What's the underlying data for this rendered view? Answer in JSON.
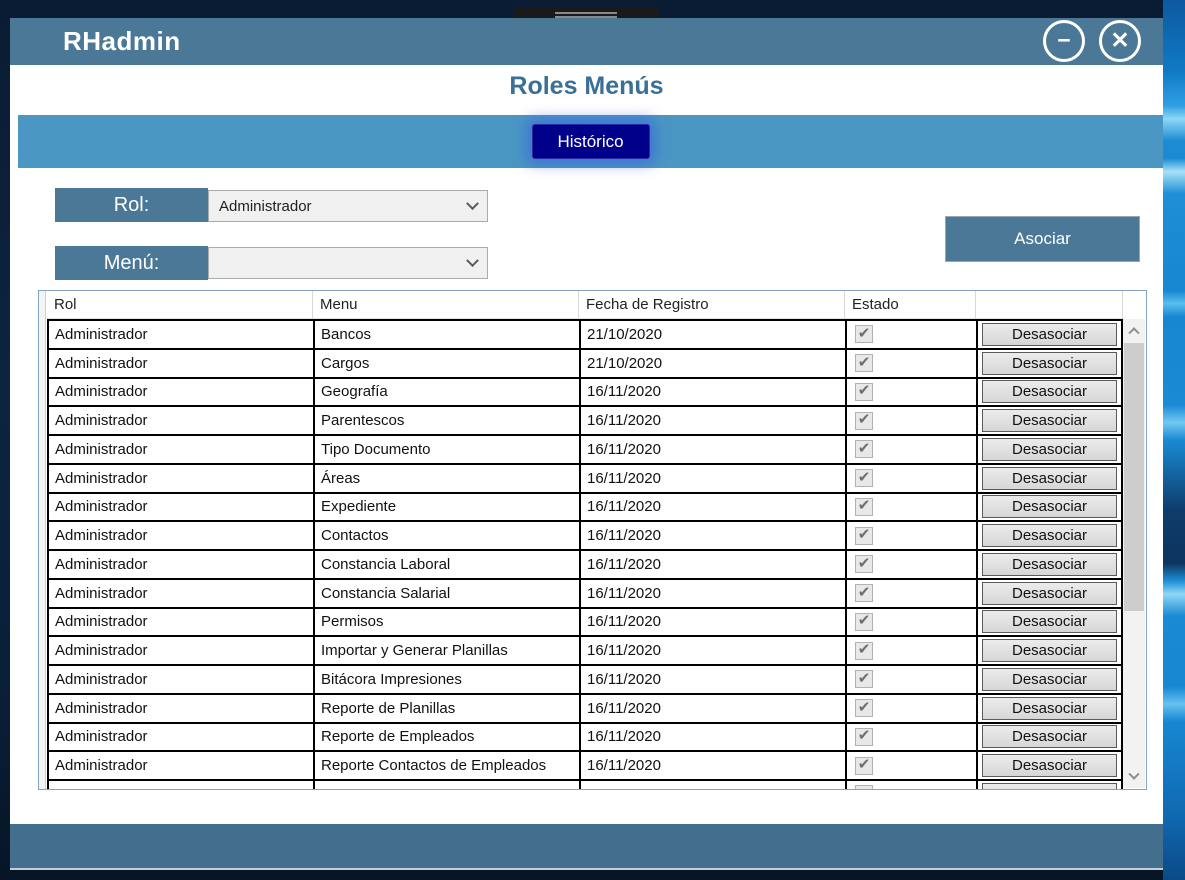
{
  "window": {
    "title": "RHadmin"
  },
  "icons": {
    "minimize": "−",
    "close": "✕",
    "check": "✔"
  },
  "page": {
    "title": "Roles Menús"
  },
  "toolbar": {
    "historico_label": "Histórico"
  },
  "filters": {
    "rol_label": "Rol:",
    "rol_value": "Administrador",
    "menu_label": "Menú:",
    "menu_value": "",
    "asociar_label": "Asociar"
  },
  "table": {
    "headers": [
      "Rol",
      "Menu",
      "Fecha de Registro",
      "Estado",
      ""
    ],
    "action_label": "Desasociar",
    "rows": [
      {
        "rol": "Administrador",
        "menu": "Bancos",
        "fecha": "21/10/2020",
        "estado": true
      },
      {
        "rol": "Administrador",
        "menu": "Cargos",
        "fecha": "21/10/2020",
        "estado": true
      },
      {
        "rol": "Administrador",
        "menu": "Geografía",
        "fecha": "16/11/2020",
        "estado": true
      },
      {
        "rol": "Administrador",
        "menu": "Parentescos",
        "fecha": "16/11/2020",
        "estado": true
      },
      {
        "rol": "Administrador",
        "menu": "Tipo Documento",
        "fecha": "16/11/2020",
        "estado": true
      },
      {
        "rol": "Administrador",
        "menu": "Áreas",
        "fecha": "16/11/2020",
        "estado": true
      },
      {
        "rol": "Administrador",
        "menu": "Expediente",
        "fecha": "16/11/2020",
        "estado": true
      },
      {
        "rol": "Administrador",
        "menu": "Contactos",
        "fecha": "16/11/2020",
        "estado": true
      },
      {
        "rol": "Administrador",
        "menu": "Constancia Laboral",
        "fecha": "16/11/2020",
        "estado": true
      },
      {
        "rol": "Administrador",
        "menu": "Constancia Salarial",
        "fecha": "16/11/2020",
        "estado": true
      },
      {
        "rol": "Administrador",
        "menu": "Permisos",
        "fecha": "16/11/2020",
        "estado": true
      },
      {
        "rol": "Administrador",
        "menu": "Importar y Generar Planillas",
        "fecha": "16/11/2020",
        "estado": true
      },
      {
        "rol": "Administrador",
        "menu": "Bitácora Impresiones",
        "fecha": "16/11/2020",
        "estado": true
      },
      {
        "rol": "Administrador",
        "menu": "Reporte de Planillas",
        "fecha": "16/11/2020",
        "estado": true
      },
      {
        "rol": "Administrador",
        "menu": "Reporte de Empleados",
        "fecha": "16/11/2020",
        "estado": true
      },
      {
        "rol": "Administrador",
        "menu": "Reporte Contactos de Empleados",
        "fecha": "16/11/2020",
        "estado": true
      }
    ],
    "partial_row_visible": true
  },
  "colors": {
    "titlebar": "#4b7896",
    "toolbar_band": "#4a97c3",
    "historico_button": "#00008b",
    "heading_text": "#3a6f98",
    "footer_bar": "#446f8c"
  }
}
